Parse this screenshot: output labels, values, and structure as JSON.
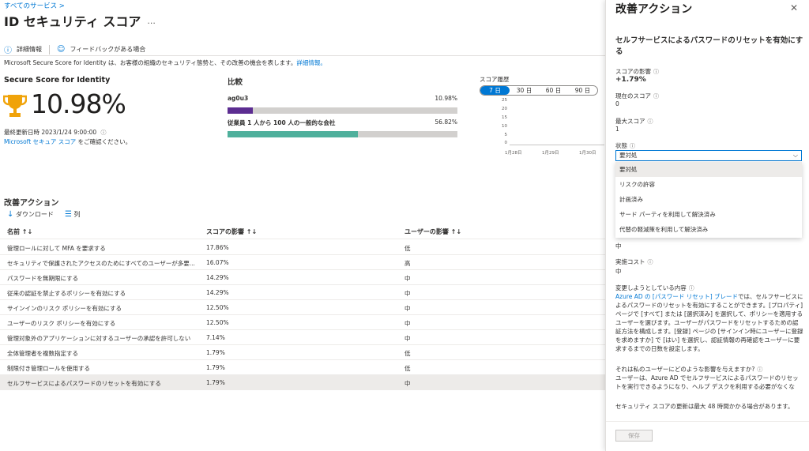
{
  "breadcrumb": "すべてのサービス >",
  "page": {
    "title": "ID セキュリティ スコア",
    "more": "···"
  },
  "cmd": {
    "info": "詳細情報",
    "feedback": "フィードバックがある場合"
  },
  "description": {
    "text": "Microsoft Secure Score for Identity は、お客様の組織のセキュリティ態勢と、その改善の機会を表します。",
    "link": "詳細情報。"
  },
  "secure_score": {
    "title": "Secure Score for Identity",
    "value": "10.98%",
    "last_updated": "最終更新日時 2023/1/24 9:00:00",
    "link": "Microsoft セキュア スコア",
    "link_suffix": "をご確認ください。"
  },
  "comparison": {
    "title": "比較",
    "rows": [
      {
        "label": "ag0u3",
        "value": "10.98%",
        "fraction": 0.1098,
        "color": "#5c2d91"
      },
      {
        "label": "従業員 1 人から 100 人の一般的な会社",
        "value": "56.82%",
        "fraction": 0.5682,
        "color": "#4fb09c"
      }
    ]
  },
  "history": {
    "title": "スコア履歴",
    "tabs": [
      "7 日",
      "30 日",
      "60 日",
      "90 日"
    ],
    "selected": 0,
    "y_ticks": [
      "25",
      "20",
      "15",
      "10",
      "5",
      "0"
    ],
    "x_ticks": [
      "1月28日",
      "1月29日",
      "1月30日"
    ]
  },
  "actions": {
    "title": "改善アクション",
    "download": "ダウンロード",
    "columns_btn": "列",
    "headers": [
      "名前 ↑↓",
      "スコアの影響 ↑↓",
      "ユーザーの影響 ↑↓"
    ],
    "rows": [
      {
        "name": "管理ロールに対して MFA を要求する",
        "score": "17.86%",
        "impact": "低"
      },
      {
        "name": "セキュリティで保護されたアクセスのためにすべてのユーザーが多要...",
        "score": "16.07%",
        "impact": "高"
      },
      {
        "name": "パスワードを無期限にする",
        "score": "14.29%",
        "impact": "中"
      },
      {
        "name": "従来の認証を禁止するポリシーを有効にする",
        "score": "14.29%",
        "impact": "中"
      },
      {
        "name": "サインインのリスク ポリシーを有効にする",
        "score": "12.50%",
        "impact": "中"
      },
      {
        "name": "ユーザーのリスク ポリシーを有効にする",
        "score": "12.50%",
        "impact": "中"
      },
      {
        "name": "管理対象外のアプリケーションに対するユーザーの承認を許可しない",
        "score": "7.14%",
        "impact": "中"
      },
      {
        "name": "全体管理者を複数指定する",
        "score": "1.79%",
        "impact": "低"
      },
      {
        "name": "制限付き管理ロールを使用する",
        "score": "1.79%",
        "impact": "低"
      },
      {
        "name": "セルフサービスによるパスワードのリセットを有効にする",
        "score": "1.79%",
        "impact": "中"
      }
    ],
    "selected_row": 9
  },
  "panel": {
    "title": "改善アクション",
    "heading": "セルフサービスによるパスワードのリセットを有効にする",
    "score_impact_label": "スコアの影響",
    "score_impact": "+1.79%",
    "current_label": "現在のスコア",
    "current": "0",
    "max_label": "最大スコア",
    "max": "1",
    "status_label": "状態",
    "status_value": "要対処",
    "status_options": [
      "要対処",
      "リスクの許容",
      "計画済み",
      "サード パーティを利用して解決済み",
      "代替の軽減策を利用して解決済み"
    ],
    "user_impact_value": "中",
    "cost_label": "実施コスト",
    "cost": "中",
    "change_label": "変更しようとしている内容",
    "change_link": "Azure AD の [パスワード リセット] ブレード",
    "change_text": "では、セルフサービスによるパスワードのリセットを有効にすることができます。[プロパティ] ページで [すべて] または [選択済み] を選択して、ポリシーを適用するユーザーを選びます。ユーザーがパスワードをリセットするための認証方法を構成します。[登録] ページの [サインイン時にユーザーに登録を求めますか] で [はい] を選択し、認証情報の再確認をユーザーに要求するまでの日数を設定します。",
    "affect_label": "それは私のユーザーにどのような影響を与えますか?",
    "affect_text": "ユーザーは、Azure AD でセルフサービスによるパスワードのリセットを実行できるようになり、ヘルプ デスクを利用する必要がなくな",
    "update_note": "セキュリティ スコアの更新は最大 48 時間かかる場合があります。",
    "save": "保存"
  }
}
